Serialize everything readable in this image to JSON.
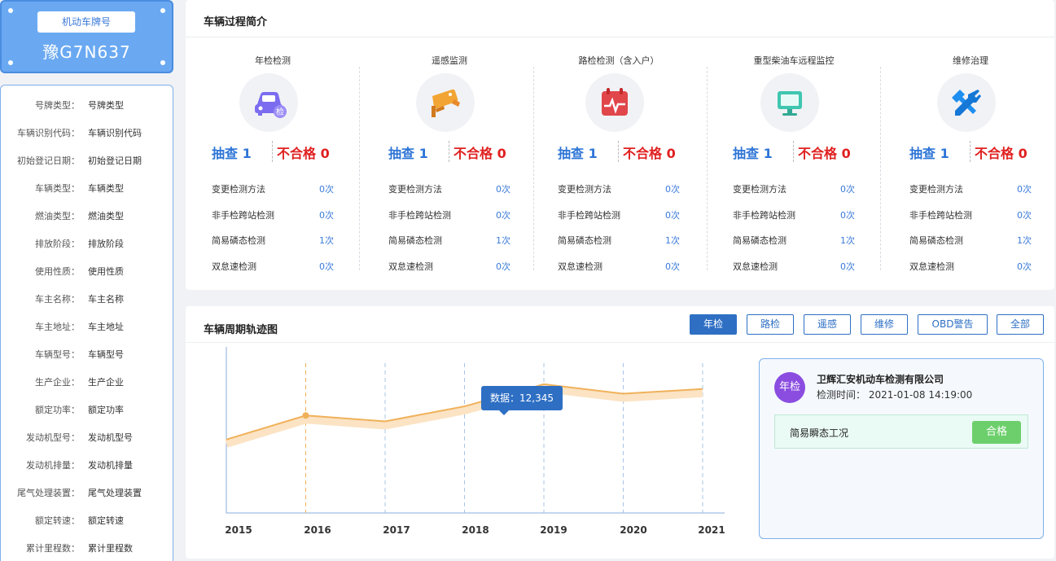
{
  "plate": {
    "label": "机动车牌号",
    "number": "豫G7N637"
  },
  "vehicle_info": [
    {
      "key": "号牌类型：",
      "value": "号牌类型"
    },
    {
      "key": "车辆识别代码：",
      "value": "车辆识别代码"
    },
    {
      "key": "初始登记日期：",
      "value": "初始登记日期"
    },
    {
      "key": "车辆类型：",
      "value": "车辆类型"
    },
    {
      "key": "燃油类型：",
      "value": "燃油类型"
    },
    {
      "key": "排放阶段：",
      "value": "排放阶段"
    },
    {
      "key": "使用性质：",
      "value": "使用性质"
    },
    {
      "key": "车主名称：",
      "value": "车主名称"
    },
    {
      "key": "车主地址：",
      "value": "车主地址"
    },
    {
      "key": "车辆型号：",
      "value": "车辆型号"
    },
    {
      "key": "生产企业：",
      "value": "生产企业"
    },
    {
      "key": "额定功率：",
      "value": "额定功率"
    },
    {
      "key": "发动机型号：",
      "value": "发动机型号"
    },
    {
      "key": "发动机排量：",
      "value": "发动机排量"
    },
    {
      "key": "尾气处理装置：",
      "value": "尾气处理装置"
    },
    {
      "key": "额定转速：",
      "value": "额定转速"
    },
    {
      "key": "累计里程数：",
      "value": "累计里程数"
    }
  ],
  "process": {
    "title": "车辆过程简介",
    "columns": [
      {
        "name": "年检检测",
        "icon": "car-inspection-icon",
        "check": "抽查 1",
        "fail": "不合格 0",
        "rows": [
          {
            "k": "变更检测方法",
            "v": "0次"
          },
          {
            "k": "非手检跨站检测",
            "v": "0次"
          },
          {
            "k": "简易磷态检测",
            "v": "1次"
          },
          {
            "k": "双怠速检测",
            "v": "0次"
          }
        ]
      },
      {
        "name": "遥感监测",
        "icon": "camera-icon",
        "check": "抽查 1",
        "fail": "不合格 0",
        "rows": [
          {
            "k": "变更检测方法",
            "v": "0次"
          },
          {
            "k": "非手检跨站检测",
            "v": "0次"
          },
          {
            "k": "简易磷态检测",
            "v": "1次"
          },
          {
            "k": "双怠速检测",
            "v": "0次"
          }
        ]
      },
      {
        "name": "路检检测（含入户）",
        "icon": "calendar-pulse-icon",
        "check": "抽查 1",
        "fail": "不合格 0",
        "rows": [
          {
            "k": "变更检测方法",
            "v": "0次"
          },
          {
            "k": "非手检跨站检测",
            "v": "0次"
          },
          {
            "k": "简易磷态检测",
            "v": "1次"
          },
          {
            "k": "双怠速检测",
            "v": "0次"
          }
        ]
      },
      {
        "name": "重型柴油车远程监控",
        "icon": "monitor-icon",
        "check": "抽查 1",
        "fail": "不合格 0",
        "rows": [
          {
            "k": "变更检测方法",
            "v": "0次"
          },
          {
            "k": "非手检跨站检测",
            "v": "0次"
          },
          {
            "k": "简易磷态检测",
            "v": "1次"
          },
          {
            "k": "双怠速检测",
            "v": "0次"
          }
        ]
      },
      {
        "name": "维修治理",
        "icon": "tools-icon",
        "check": "抽查 1",
        "fail": "不合格 0",
        "rows": [
          {
            "k": "变更检测方法",
            "v": "0次"
          },
          {
            "k": "非手检跨站检测",
            "v": "0次"
          },
          {
            "k": "简易磷态检测",
            "v": "1次"
          },
          {
            "k": "双怠速检测",
            "v": "0次"
          }
        ]
      }
    ]
  },
  "timeline": {
    "title": "车辆周期轨迹图",
    "filters": [
      "年检",
      "路检",
      "遥感",
      "维修",
      "OBD警告",
      "全部"
    ],
    "active_filter": "年检",
    "tooltip": "数据：12,345",
    "record": {
      "badge": "年检",
      "company": "卫辉汇安机动车检测有限公司",
      "time": "检测时间：  2021-01-08 14:19:00",
      "condition": "简易瞬态工况",
      "result": "合格"
    }
  },
  "colors": {
    "accent": "#2e6fc4",
    "line": "#f0b15a",
    "fail": "#e02020",
    "pass": "#6ccf6b"
  },
  "chart_data": {
    "type": "line",
    "x": [
      "2015",
      "2016",
      "2017",
      "2018",
      "2019",
      "2020",
      "2021"
    ],
    "series": [
      {
        "values": [
          9300,
          12345,
          11600,
          13500,
          16300,
          15100,
          15700
        ]
      }
    ],
    "ylim": [
      0,
      20000
    ],
    "highlight": {
      "x": "2016",
      "label": "数据：12,345"
    },
    "grid": "vertical-dashed"
  }
}
